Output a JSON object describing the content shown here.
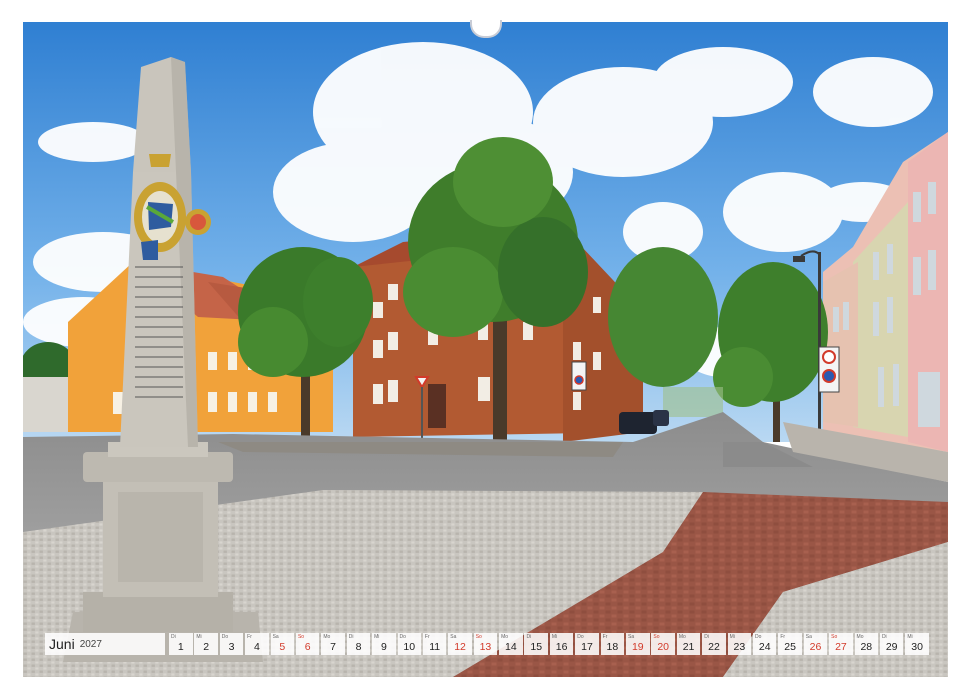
{
  "calendar": {
    "month": "Juni",
    "year": "2027",
    "days": [
      {
        "wd": "Di",
        "n": "1",
        "type": "work"
      },
      {
        "wd": "Mi",
        "n": "2",
        "type": "work"
      },
      {
        "wd": "Do",
        "n": "3",
        "type": "work"
      },
      {
        "wd": "Fr",
        "n": "4",
        "type": "work"
      },
      {
        "wd": "Sa",
        "n": "5",
        "type": "sat"
      },
      {
        "wd": "So",
        "n": "6",
        "type": "sun"
      },
      {
        "wd": "Mo",
        "n": "7",
        "type": "work"
      },
      {
        "wd": "Di",
        "n": "8",
        "type": "work"
      },
      {
        "wd": "Mi",
        "n": "9",
        "type": "work"
      },
      {
        "wd": "Do",
        "n": "10",
        "type": "work"
      },
      {
        "wd": "Fr",
        "n": "11",
        "type": "work"
      },
      {
        "wd": "Sa",
        "n": "12",
        "type": "sat"
      },
      {
        "wd": "So",
        "n": "13",
        "type": "sun"
      },
      {
        "wd": "Mo",
        "n": "14",
        "type": "work"
      },
      {
        "wd": "Di",
        "n": "15",
        "type": "work"
      },
      {
        "wd": "Mi",
        "n": "16",
        "type": "work"
      },
      {
        "wd": "Do",
        "n": "17",
        "type": "work"
      },
      {
        "wd": "Fr",
        "n": "18",
        "type": "work"
      },
      {
        "wd": "Sa",
        "n": "19",
        "type": "sat"
      },
      {
        "wd": "So",
        "n": "20",
        "type": "sun"
      },
      {
        "wd": "Mo",
        "n": "21",
        "type": "work"
      },
      {
        "wd": "Di",
        "n": "22",
        "type": "work"
      },
      {
        "wd": "Mi",
        "n": "23",
        "type": "work"
      },
      {
        "wd": "Do",
        "n": "24",
        "type": "work"
      },
      {
        "wd": "Fr",
        "n": "25",
        "type": "work"
      },
      {
        "wd": "Sa",
        "n": "26",
        "type": "sat"
      },
      {
        "wd": "So",
        "n": "27",
        "type": "sun"
      },
      {
        "wd": "Mo",
        "n": "28",
        "type": "work"
      },
      {
        "wd": "Di",
        "n": "29",
        "type": "work"
      },
      {
        "wd": "Mi",
        "n": "30",
        "type": "work"
      }
    ]
  },
  "colors": {
    "sky": "#3f8fd8",
    "brick": "#b25a32",
    "yellow_house": "#f1a23a",
    "pink_house": "#e8b8b0",
    "sunday": "#d23a2a"
  }
}
